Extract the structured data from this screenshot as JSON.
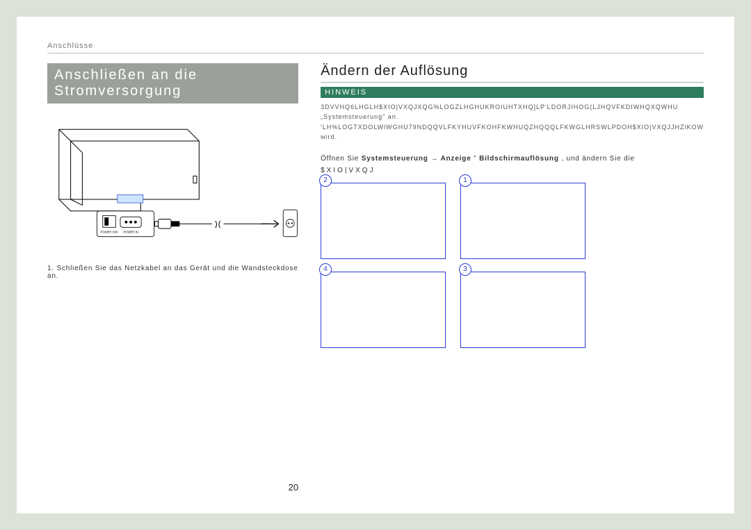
{
  "header": "Anschlüsse",
  "left": {
    "title": "Anschließen an die Stromversorgung",
    "caption": "1.  Schließen Sie das Netzkabel an das Gerät und die Wandsteckdose an.",
    "labels": {
      "power_sw": "POWER S/W",
      "power_in": "POWER IN"
    }
  },
  "right": {
    "title": "Ändern der Auflösung",
    "hinweis": "HINWEIS",
    "note_line1": "3DVVHQ6LHGLH$XIO|VXQJXQG%LOGZLHGHUKROIUHTXHQ]LP'LDORJIHOG(LJHQVFKDIWHQXQWHU",
    "note_quoted": "„Systemsteuerung\" an.",
    "note_line2": "'LH%LOGTXDOLWlWGHU79NDQQVLFKYHUVFKOHFKWHUQZHQQQLFKWGLHRSWLPDOH$XIO|VXQJJHZlKOW",
    "note_line3": "wird.",
    "instruction_pre": "Öffnen Sie ",
    "instruction_b1": "Systemsteuerung",
    "instruction_arrow": " → ",
    "instruction_b2": "Anzeige",
    "instruction_quote_open": "  \"  ",
    "instruction_b3": "Bildschirmauflösung",
    "instruction_post": "   , und ändern Sie die",
    "aux": "$XIO|VXQJ"
  },
  "steps": {
    "tl": "2",
    "tr": "1",
    "bl": "4",
    "br": "3"
  },
  "page_number": "20"
}
